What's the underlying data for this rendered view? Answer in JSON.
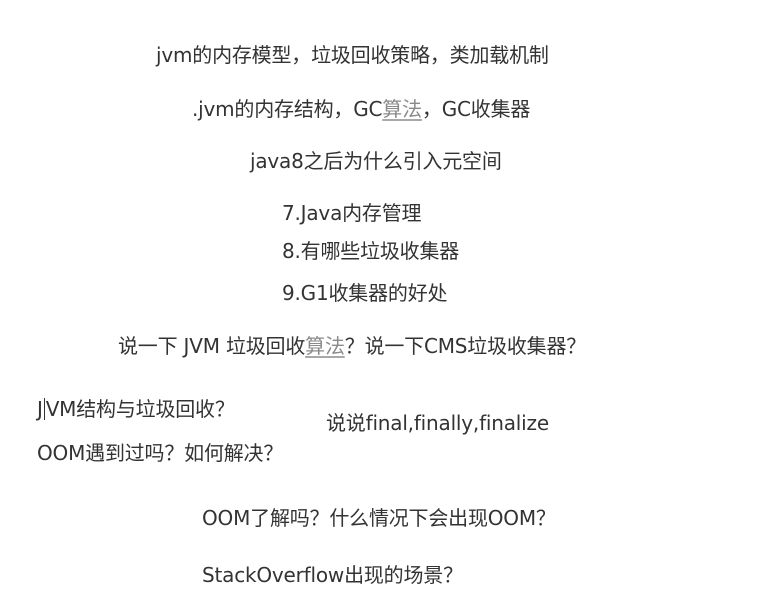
{
  "lines": {
    "l1": "jvm的内存模型，垃圾回收策略，类加载机制",
    "l2": {
      "prefix": ".jvm的内存结构，GC",
      "link": "算法",
      "suffix": "，GC收集器"
    },
    "l3": "java8之后为什么引入元空间",
    "l4": "7.Java内存管理",
    "l5": "8.有哪些垃圾收集器",
    "l6": "9.G1收集器的好处",
    "l7": {
      "prefix": "说一下 JVM 垃圾回收",
      "link": "算法",
      "suffix": "？说一下CMS垃圾收集器？"
    },
    "l8": {
      "first": "J",
      "rest": "VM结构与垃圾回收？"
    },
    "l9": "说说final,finally,finalize",
    "l10": "OOM遇到过吗？如何解决？",
    "l11": "OOM了解吗？什么情况下会出现OOM？",
    "l12": "StackOverflow出现的场景？"
  }
}
